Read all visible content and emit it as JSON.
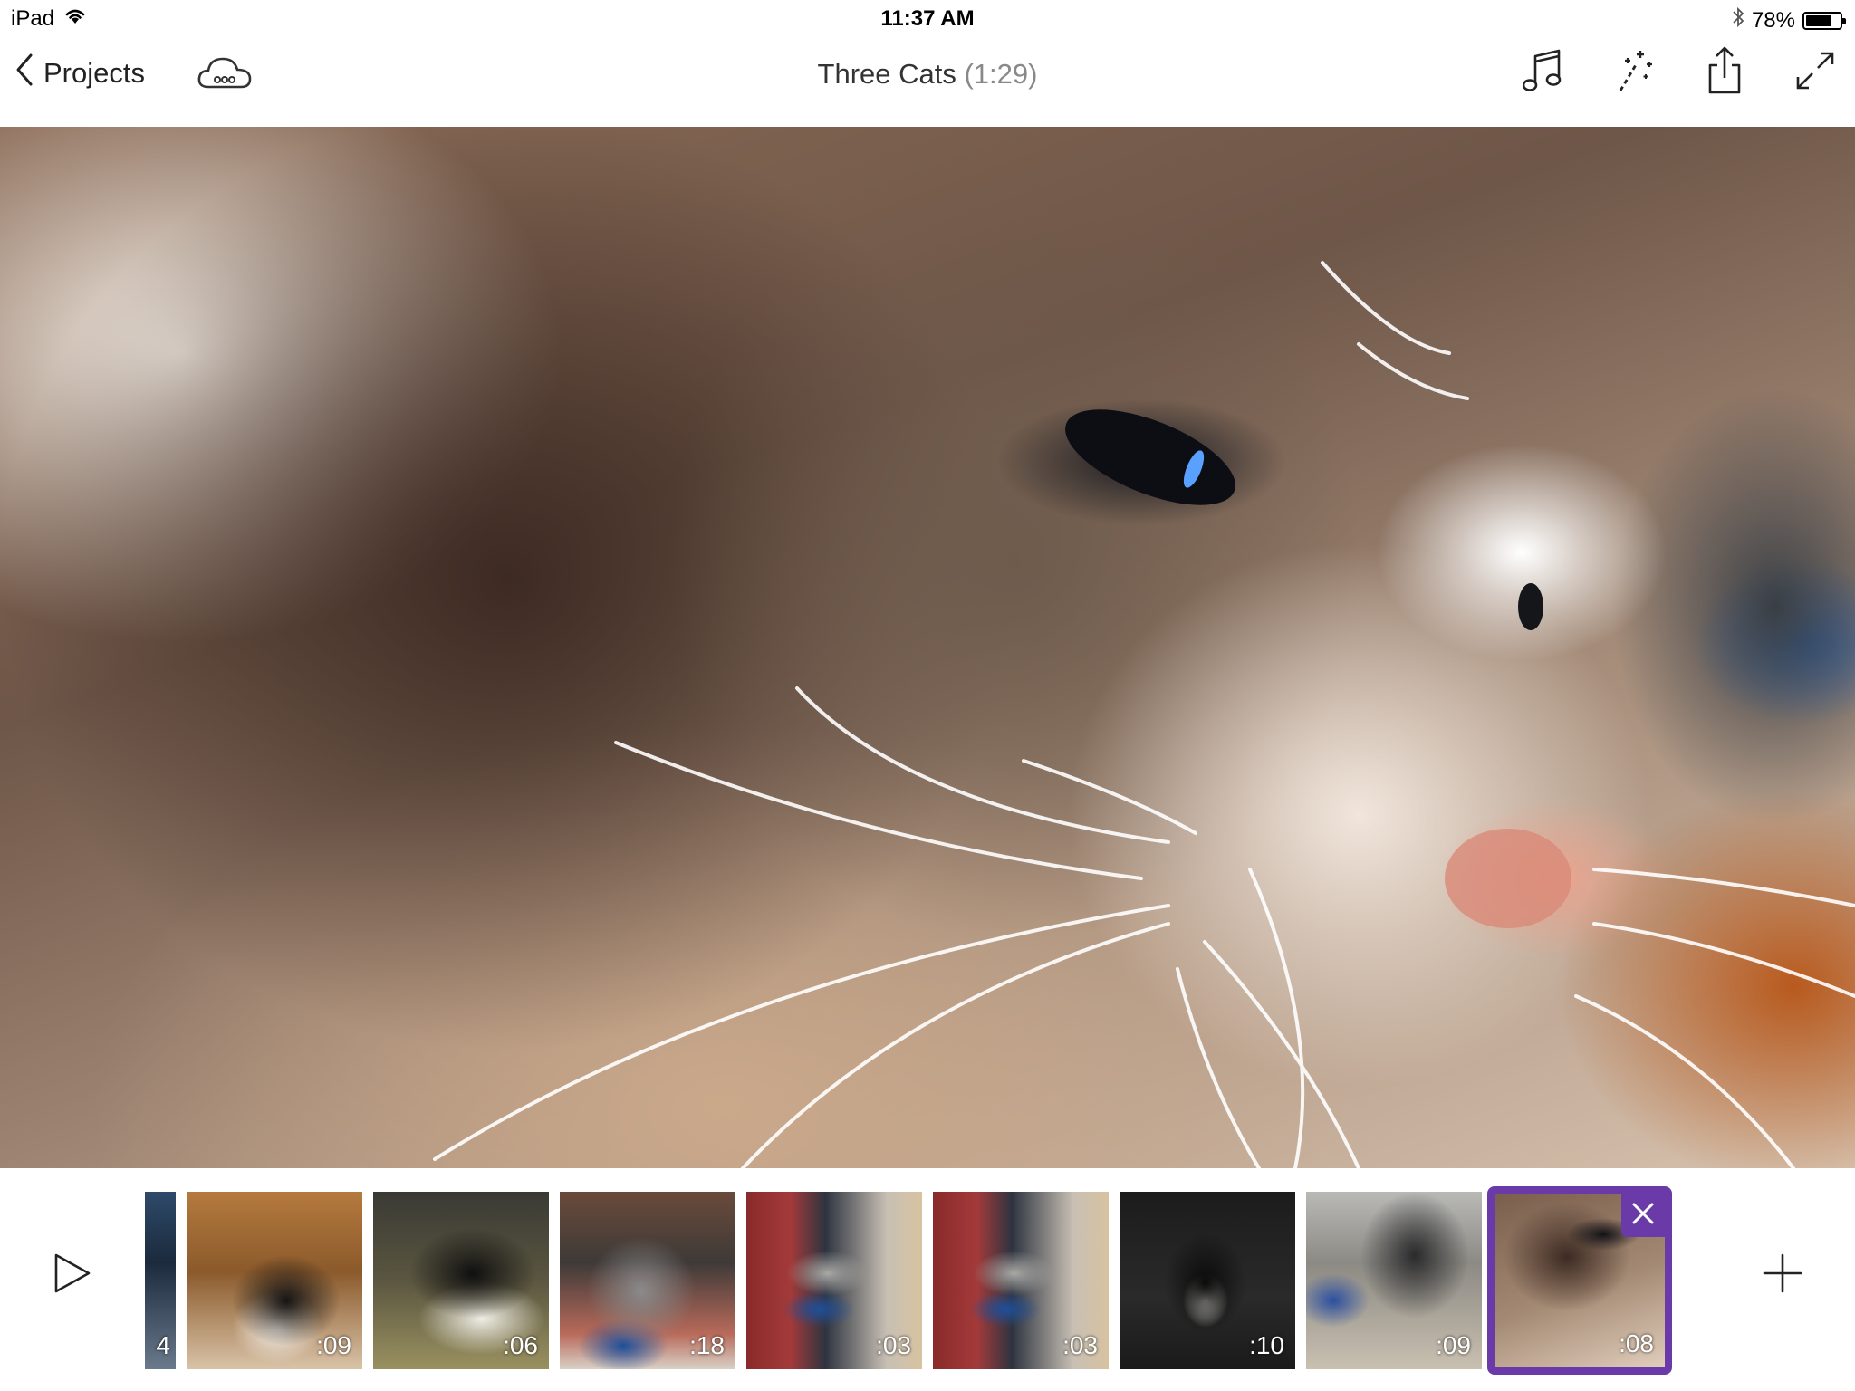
{
  "status_bar": {
    "device": "iPad",
    "time": "11:37 AM",
    "battery_percent": "78%",
    "battery_level": 0.78,
    "icons": [
      "wifi-icon",
      "bluetooth-icon",
      "battery-icon"
    ]
  },
  "nav": {
    "back_label": "Projects",
    "title": "Three Cats",
    "duration": "(1:29)",
    "icons": [
      "chevron-left-icon",
      "cloud-sync-icon",
      "music-note-icon",
      "magic-wand-icon",
      "share-icon",
      "fullscreen-icon"
    ]
  },
  "preview": {
    "subject": "close-up cat photo"
  },
  "timeline": {
    "play_icon": "play-icon",
    "add_icon": "plus-icon",
    "clips": [
      {
        "duration": "4"
      },
      {
        "duration": ":09"
      },
      {
        "duration": ":06"
      },
      {
        "duration": ":18"
      },
      {
        "duration": ":03"
      },
      {
        "duration": ":03"
      },
      {
        "duration": ":10"
      },
      {
        "duration": ":09"
      },
      {
        "duration": ":08",
        "selected": true
      }
    ],
    "remove_icon": "close-icon"
  },
  "colors": {
    "accent": "#6a3aa8"
  }
}
